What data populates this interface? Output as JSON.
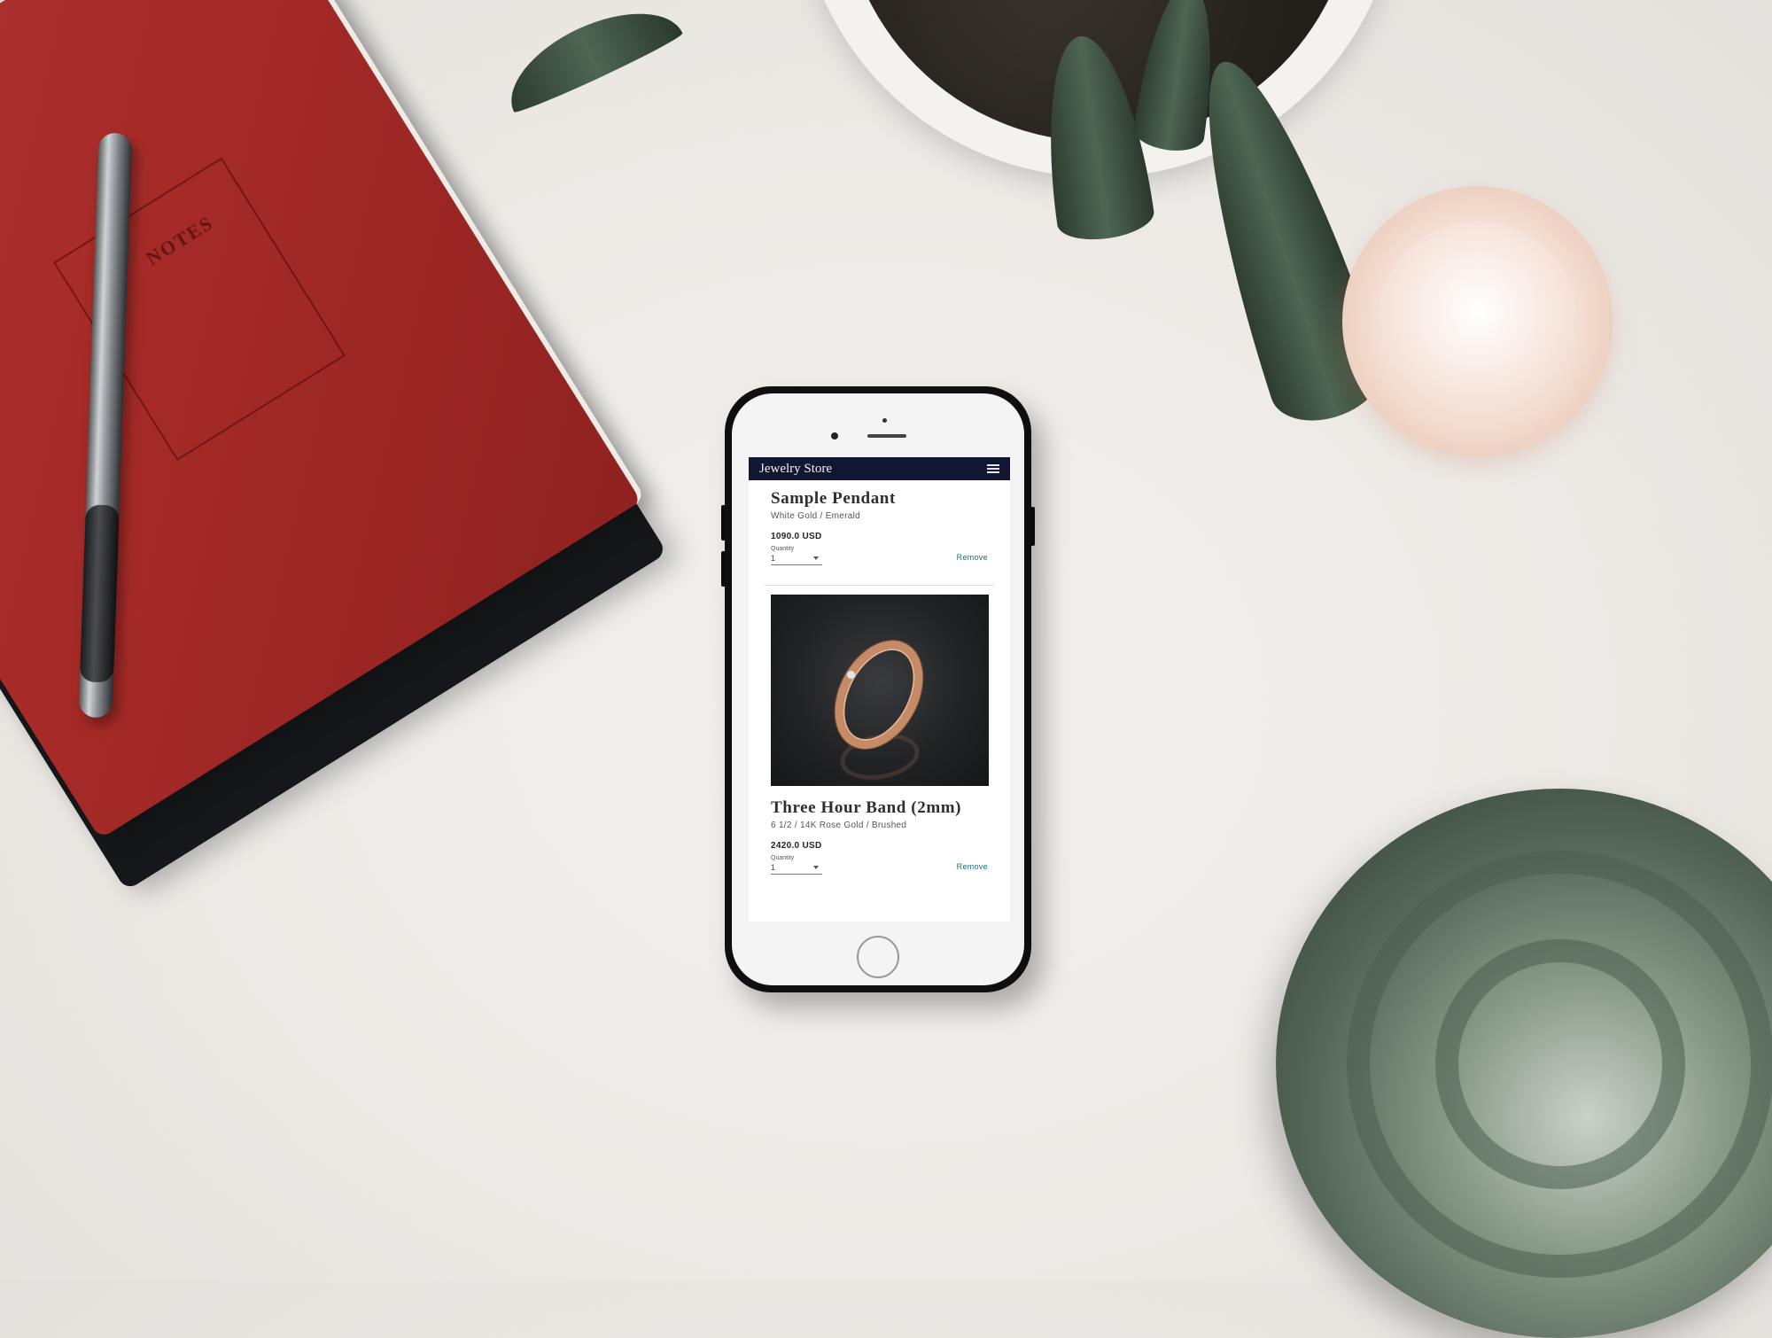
{
  "app": {
    "brand": "Jewelry Store",
    "menu_icon": "hamburger-menu-icon",
    "nav_color": "#111733"
  },
  "background": {
    "notebook_label": "NOTES"
  },
  "cart": {
    "items": [
      {
        "title": "Sample Pendant",
        "variant": "White Gold / Emerald",
        "price": "1090.0 USD",
        "quantity_label": "Quantity",
        "quantity_value": "1",
        "remove_label": "Remove",
        "has_image": false
      },
      {
        "title": "Three Hour Band (2mm)",
        "variant": "6 1/2 / 14K Rose Gold / Brushed",
        "price": "2420.0 USD",
        "quantity_label": "Quantity",
        "quantity_value": "1",
        "remove_label": "Remove",
        "has_image": true,
        "image_icon": "rose-gold-ring-image"
      }
    ]
  },
  "colors": {
    "link": "#1d6b7a",
    "accent": "#111733"
  }
}
